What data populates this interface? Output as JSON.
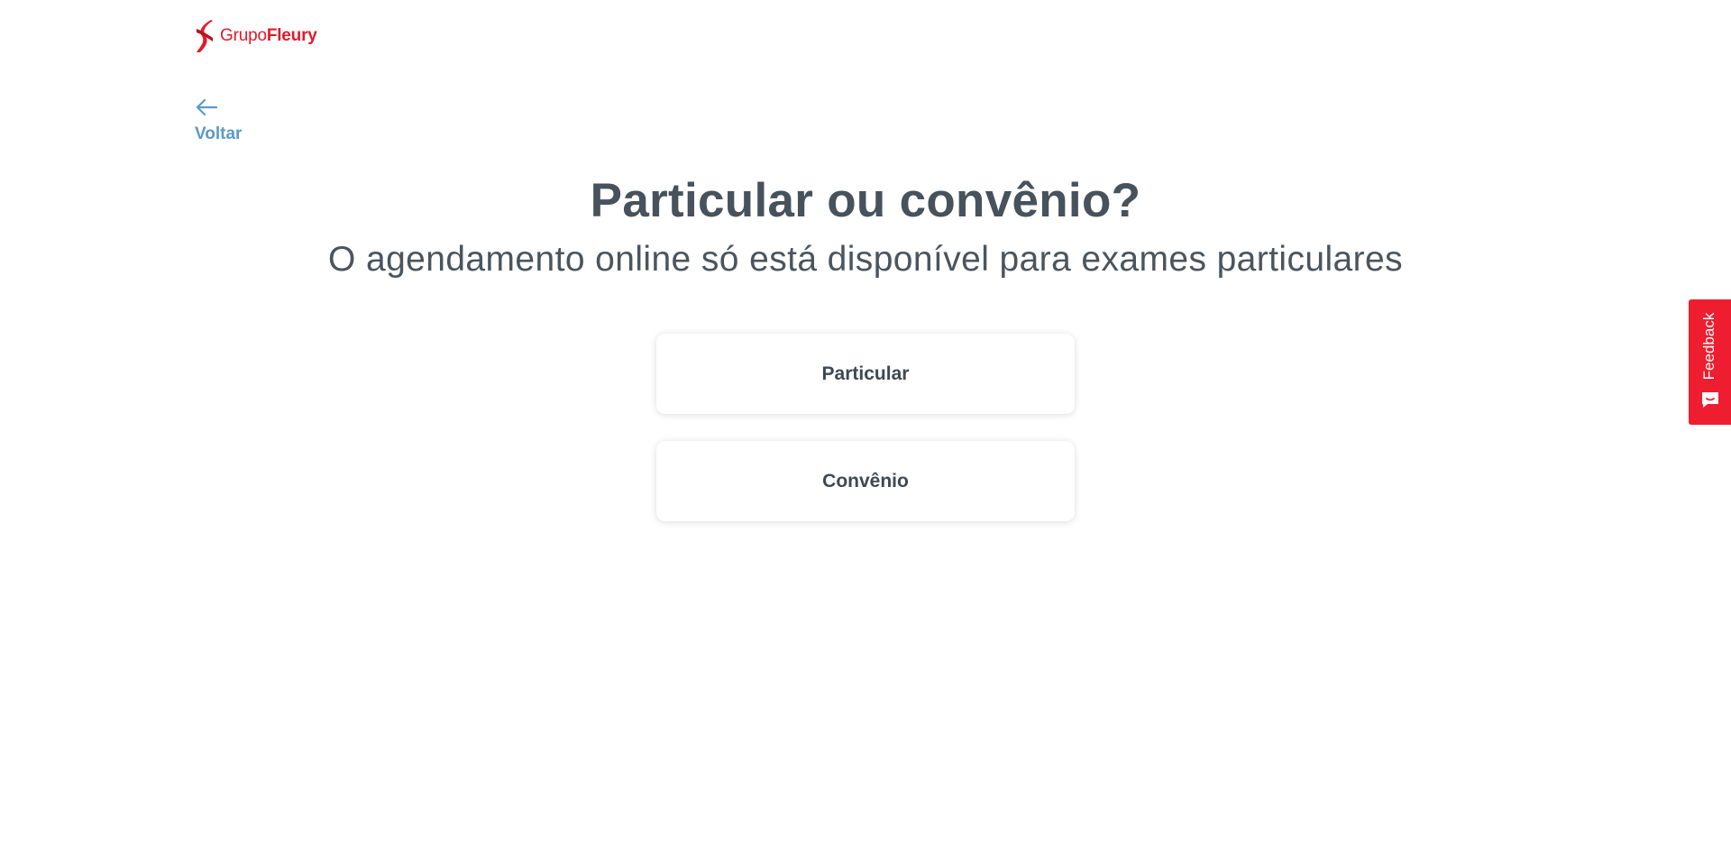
{
  "header": {
    "logo_light": "Grupo",
    "logo_bold": "Fleury",
    "brand_color": "#e21a2c"
  },
  "nav": {
    "back_label": "Voltar",
    "back_icon": "arrow-left-icon",
    "link_color": "#5b9ac7"
  },
  "main": {
    "title": "Particular ou convênio?",
    "subtitle": "O agendamento online só está disponível para exames particulares",
    "options": [
      {
        "label": "Particular"
      },
      {
        "label": "Convênio"
      }
    ]
  },
  "feedback": {
    "label": "Feedback",
    "icon": "chat-smile-icon",
    "color": "#ee1d2f"
  }
}
